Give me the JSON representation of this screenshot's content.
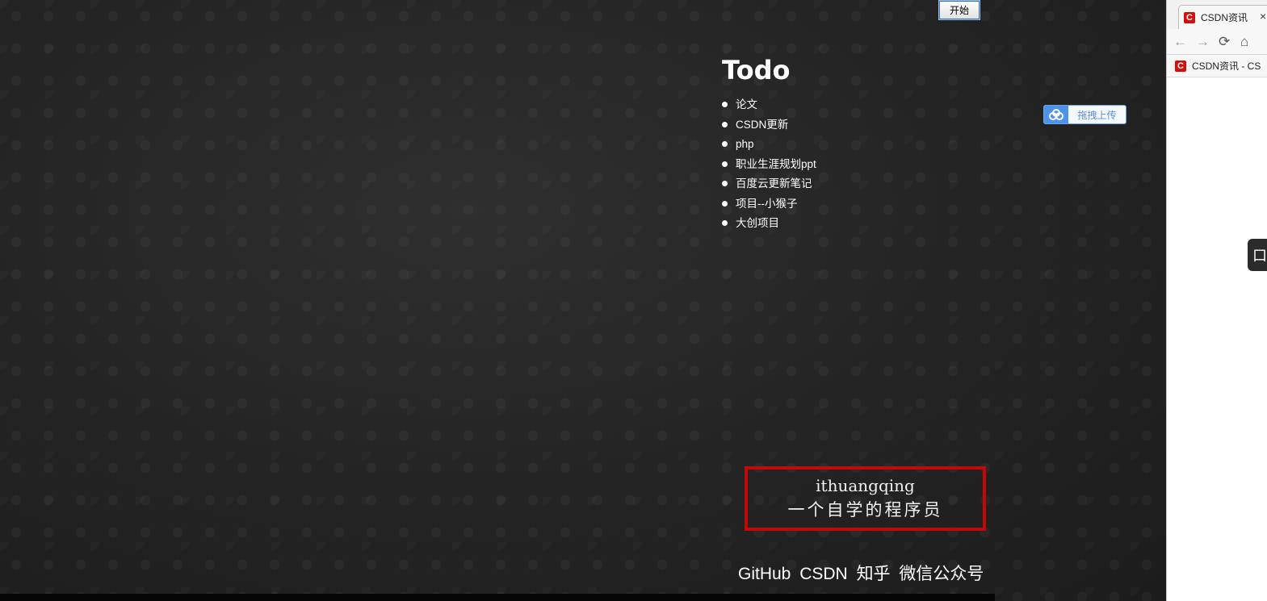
{
  "desktop": {
    "start_button": "开始",
    "todo": {
      "title": "Todo",
      "items": [
        "论文",
        "CSDN更新",
        "php",
        "职业生涯规划ppt",
        "百度云更新笔记",
        "项目--小猴子",
        "大创项目"
      ]
    },
    "upload_widget": {
      "label": "拖拽上传",
      "icon": "baidu-cloud-icon"
    },
    "signature": {
      "line1": "ithuangqing",
      "line2": "一个自学的程序员"
    },
    "links": [
      "GitHub",
      "CSDN",
      "知乎",
      "微信公众号"
    ]
  },
  "browser": {
    "tab_title": "CSDN资讯",
    "tab_close": "×",
    "nav": {
      "back": "←",
      "forward": "→",
      "reload": "⟳",
      "home": "⌂"
    },
    "bookmark": "CSDN资讯 - CS",
    "side_tab_text": "口",
    "logo_letter": "C"
  },
  "colors": {
    "accent_red": "#c40808",
    "csdn_red": "#d30e0e",
    "upload_blue": "#4f92ea"
  }
}
